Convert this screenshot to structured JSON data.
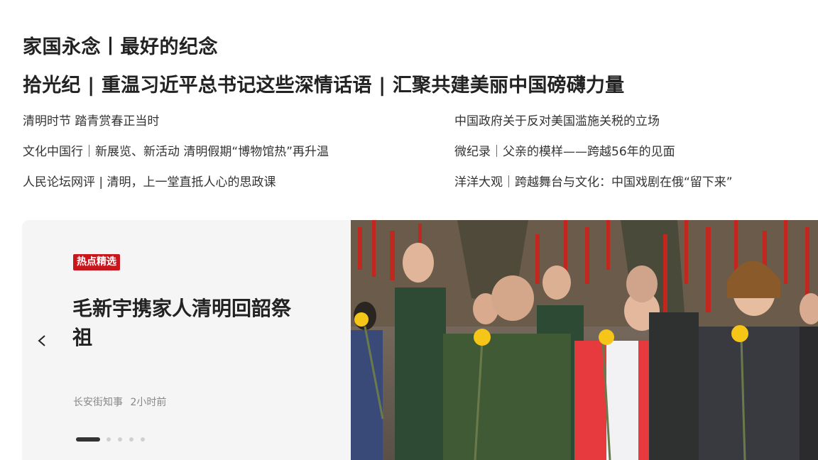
{
  "headlines": {
    "first": "家国永念丨最好的纪念",
    "second": "拾光纪 | 重温习近平总书记这些深情话语 | 汇聚共建美丽中国磅礴力量"
  },
  "links": {
    "left": [
      "清明时节 踏青赏春正当时",
      "文化中国行｜新展览、新活动 清明假期“博物馆热”再升温",
      "人民论坛网评 | 清明，上一堂直抵人心的思政课"
    ],
    "right": [
      "中国政府关于反对美国滥施关税的立场",
      "微纪录｜父亲的模样——跨越56年的见面",
      "洋洋大观｜跨越舞台与文化：中国戏剧在俄“留下来”"
    ]
  },
  "carousel": {
    "badge": "热点精选",
    "title": "毛新宇携家人清明回韶祭祖",
    "source": "长安街知事",
    "time": "2小时前",
    "active_slide": 1,
    "slide_count": 5,
    "prev_icon": "chevron-left-icon",
    "photo": "news-photo"
  },
  "colors": {
    "badge_bg": "#c8161d",
    "card_bg": "#f5f5f5",
    "headline": "#222222",
    "link": "#333333",
    "meta": "#888888"
  }
}
